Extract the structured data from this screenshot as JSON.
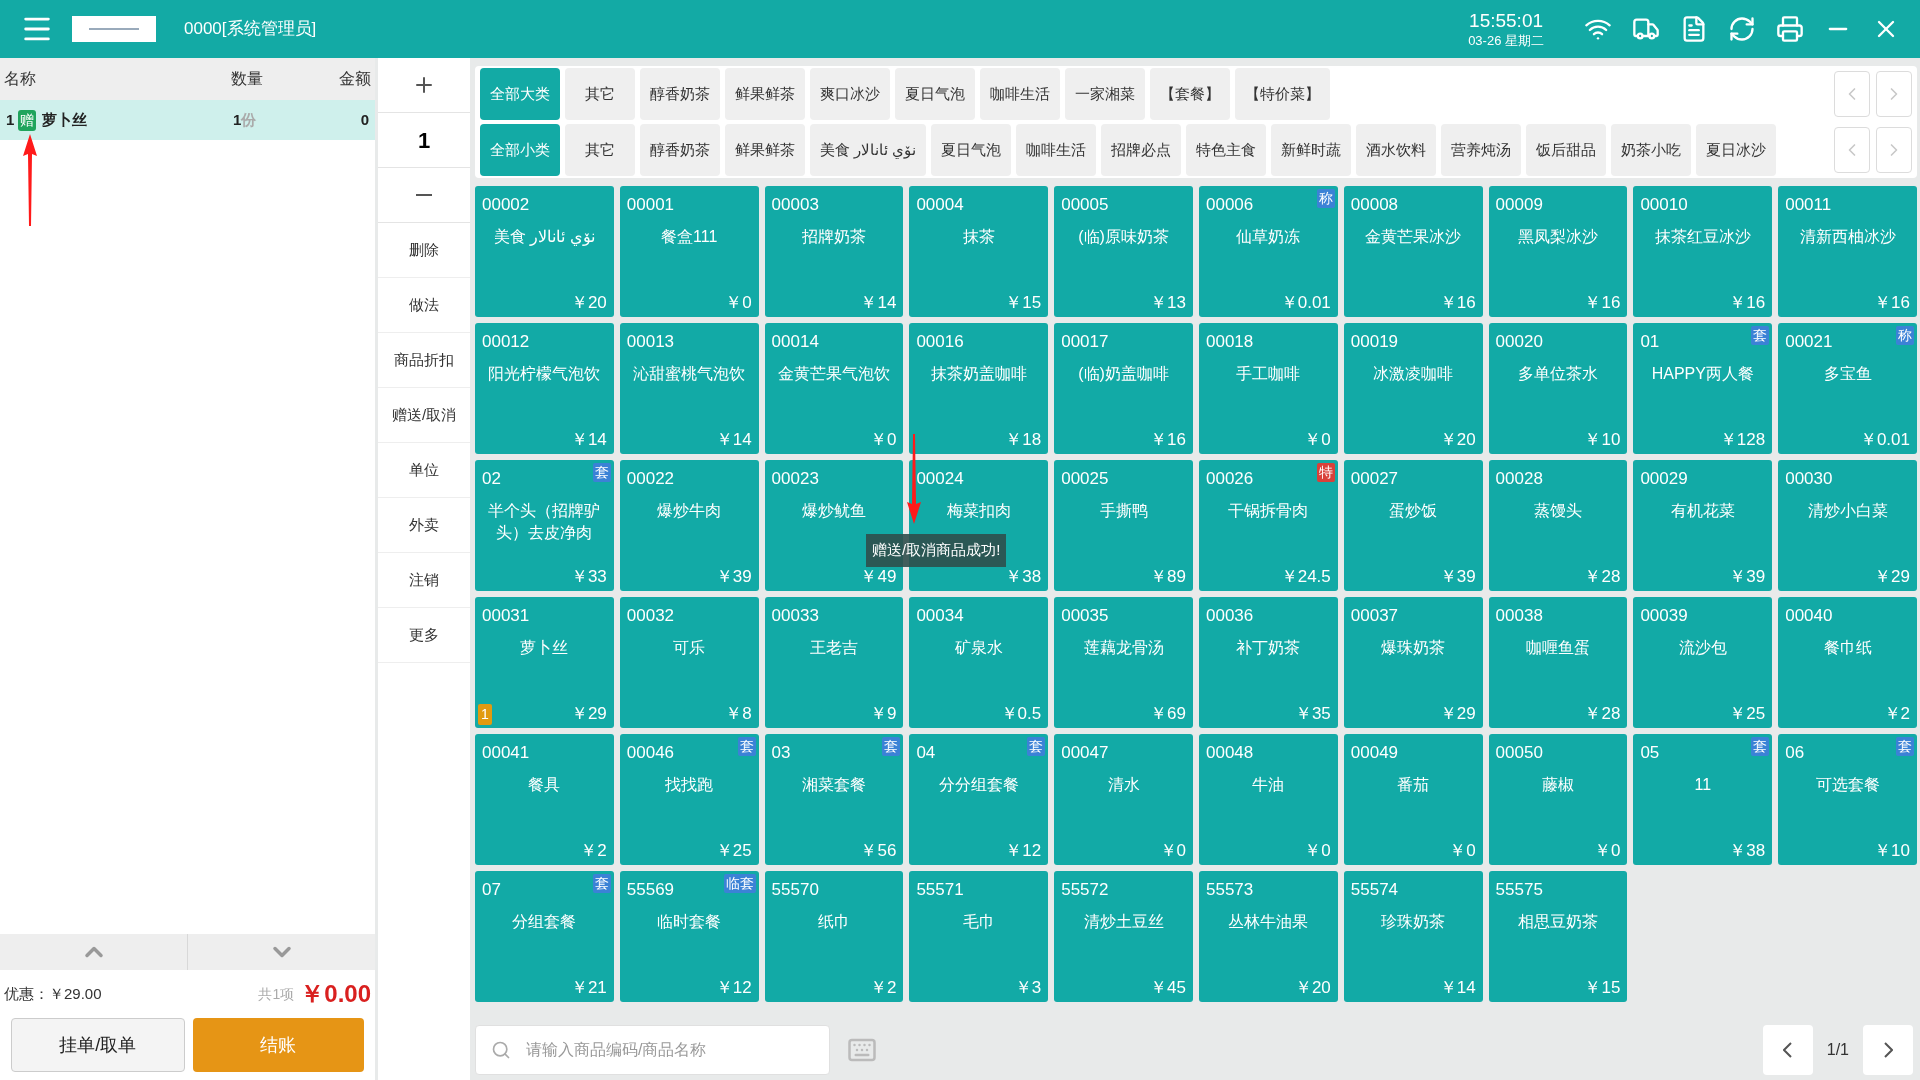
{
  "header": {
    "operator": "0000[系统管理员]",
    "time": "15:55:01",
    "date": "03-26 星期二"
  },
  "order": {
    "columns": [
      "名称",
      "数量",
      "金额"
    ],
    "items": [
      {
        "index": "1",
        "tag": "赠",
        "name": "萝卜丝",
        "qty": "1",
        "unit": "份",
        "amount": "0",
        "selected": true
      }
    ],
    "discount": "优惠：￥29.00",
    "count": "共1项",
    "total": "￥0.00",
    "buttons": [
      {
        "label": "挂单/取单",
        "kind": "plain"
      },
      {
        "label": "结账",
        "kind": "primary"
      }
    ]
  },
  "quantity": "1",
  "actions": [
    "删除",
    "做法",
    "商品折扣",
    "赠送/取消",
    "单位",
    "外卖",
    "注销",
    "更多"
  ],
  "categories": [
    {
      "label": "全部大类",
      "selected": true
    },
    {
      "label": "其它",
      "selected": false
    },
    {
      "label": "醇香奶茶",
      "selected": false
    },
    {
      "label": "鲜果鲜茶",
      "selected": false
    },
    {
      "label": "爽口冰沙",
      "selected": false
    },
    {
      "label": "夏日气泡",
      "selected": false
    },
    {
      "label": "咖啡生活",
      "selected": false
    },
    {
      "label": "一家湘菜",
      "selected": false
    },
    {
      "label": "【套餐】",
      "selected": false
    },
    {
      "label": "【特价菜】",
      "selected": false
    }
  ],
  "subcategories": [
    {
      "label": "全部小类",
      "selected": true
    },
    {
      "label": "其它",
      "selected": false
    },
    {
      "label": "醇香奶茶",
      "selected": false
    },
    {
      "label": "鲜果鲜茶",
      "selected": false
    },
    {
      "label": "美食 نۆي ئانالار",
      "selected": false
    },
    {
      "label": "夏日气泡",
      "selected": false
    },
    {
      "label": "咖啡生活",
      "selected": false
    },
    {
      "label": "招牌必点",
      "selected": false
    },
    {
      "label": "特色主食",
      "selected": false
    },
    {
      "label": "新鲜时蔬",
      "selected": false
    },
    {
      "label": "酒水饮料",
      "selected": false
    },
    {
      "label": "营养炖汤",
      "selected": false
    },
    {
      "label": "饭后甜品",
      "selected": false
    },
    {
      "label": "奶茶小吃",
      "selected": false
    },
    {
      "label": "夏日冰沙",
      "selected": false
    }
  ],
  "products": [
    {
      "code": "00002",
      "name": "美食 نۆي ئانالار",
      "price": "￥20"
    },
    {
      "code": "00001",
      "name": "餐盒111",
      "price": "￥0"
    },
    {
      "code": "00003",
      "name": "招牌奶茶",
      "price": "￥14"
    },
    {
      "code": "00004",
      "name": "抹茶",
      "price": "￥15"
    },
    {
      "code": "00005",
      "name": "(临)原味奶茶",
      "price": "￥13"
    },
    {
      "code": "00006",
      "name": "仙草奶冻",
      "price": "￥0.01",
      "badge": "称",
      "color": "#3b82d6"
    },
    {
      "code": "00008",
      "name": "金黄芒果冰沙",
      "price": "￥16"
    },
    {
      "code": "00009",
      "name": "黑凤梨冰沙",
      "price": "￥16"
    },
    {
      "code": "00010",
      "name": "抹茶红豆冰沙",
      "price": "￥16"
    },
    {
      "code": "00011",
      "name": "清新西柚冰沙",
      "price": "￥16"
    },
    {
      "code": "00012",
      "name": "阳光柠檬气泡饮",
      "price": "￥14"
    },
    {
      "code": "00013",
      "name": "沁甜蜜桃气泡饮",
      "price": "￥14"
    },
    {
      "code": "00014",
      "name": "金黄芒果气泡饮",
      "price": "￥0"
    },
    {
      "code": "00016",
      "name": "抹茶奶盖咖啡",
      "price": "￥18"
    },
    {
      "code": "00017",
      "name": "(临)奶盖咖啡",
      "price": "￥16"
    },
    {
      "code": "00018",
      "name": "手工咖啡",
      "price": "￥0"
    },
    {
      "code": "00019",
      "name": "冰激凌咖啡",
      "price": "￥20"
    },
    {
      "code": "00020",
      "name": "多单位茶水",
      "price": "￥10"
    },
    {
      "code": "01",
      "name": "HAPPY两人餐",
      "price": "￥128",
      "badge": "套",
      "color": "#3b82d6"
    },
    {
      "code": "00021",
      "name": "多宝鱼",
      "price": "￥0.01",
      "badge": "称",
      "color": "#3b82d6"
    },
    {
      "code": "02",
      "name": "半个头（招牌驴头）去皮净肉",
      "price": "￥33",
      "badge": "套",
      "color": "#3b82d6"
    },
    {
      "code": "00022",
      "name": "爆炒牛肉",
      "price": "￥39"
    },
    {
      "code": "00023",
      "name": "爆炒鱿鱼",
      "price": "￥49"
    },
    {
      "code": "00024",
      "name": "梅菜扣肉",
      "price": "￥38"
    },
    {
      "code": "00025",
      "name": "手撕鸭",
      "price": "￥89"
    },
    {
      "code": "00026",
      "name": "干锅拆骨肉",
      "price": "￥24.5",
      "badge": "特",
      "color": "#d9413a"
    },
    {
      "code": "00027",
      "name": "蛋炒饭",
      "price": "￥39"
    },
    {
      "code": "00028",
      "name": "蒸馒头",
      "price": "￥28"
    },
    {
      "code": "00029",
      "name": "有机花菜",
      "price": "￥39"
    },
    {
      "code": "00030",
      "name": "清炒小白菜",
      "price": "￥29"
    },
    {
      "code": "00031",
      "name": "萝卜丝",
      "price": "￥29",
      "count": "1"
    },
    {
      "code": "00032",
      "name": "可乐",
      "price": "￥8"
    },
    {
      "code": "00033",
      "name": "王老吉",
      "price": "￥9"
    },
    {
      "code": "00034",
      "name": "矿泉水",
      "price": "￥0.5"
    },
    {
      "code": "00035",
      "name": "莲藕龙骨汤",
      "price": "￥69"
    },
    {
      "code": "00036",
      "name": "补丁奶茶",
      "price": "￥35"
    },
    {
      "code": "00037",
      "name": "爆珠奶茶",
      "price": "￥29"
    },
    {
      "code": "00038",
      "name": "咖喱鱼蛋",
      "price": "￥28"
    },
    {
      "code": "00039",
      "name": "流沙包",
      "price": "￥25"
    },
    {
      "code": "00040",
      "name": "餐巾纸",
      "price": "￥2"
    },
    {
      "code": "00041",
      "name": "餐具",
      "price": "￥2"
    },
    {
      "code": "00046",
      "name": "找找跑",
      "price": "￥25",
      "badge": "套",
      "color": "#3b82d6"
    },
    {
      "code": "03",
      "name": "湘菜套餐",
      "price": "￥56",
      "badge": "套",
      "color": "#3b82d6"
    },
    {
      "code": "04",
      "name": "分分组套餐",
      "price": "￥12",
      "badge": "套",
      "color": "#3b82d6"
    },
    {
      "code": "00047",
      "name": "清水",
      "price": "￥0"
    },
    {
      "code": "00048",
      "name": "牛油",
      "price": "￥0"
    },
    {
      "code": "00049",
      "name": "番茄",
      "price": "￥0"
    },
    {
      "code": "00050",
      "name": "藤椒",
      "price": "￥0"
    },
    {
      "code": "05",
      "name": "11",
      "price": "￥38",
      "badge": "套",
      "color": "#3b82d6"
    },
    {
      "code": "06",
      "name": "可选套餐",
      "price": "￥10",
      "badge": "套",
      "color": "#3b82d6"
    },
    {
      "code": "07",
      "name": "分组套餐",
      "price": "￥21",
      "badge": "套",
      "color": "#3b82d6"
    },
    {
      "code": "55569",
      "name": "临时套餐",
      "price": "￥12",
      "badge": "临套",
      "color": "#3b82d6"
    },
    {
      "code": "55570",
      "name": "纸巾",
      "price": "￥2"
    },
    {
      "code": "55571",
      "name": "毛巾",
      "price": "￥3"
    },
    {
      "code": "55572",
      "name": "清炒土豆丝",
      "price": "￥45"
    },
    {
      "code": "55573",
      "name": "丛林牛油果",
      "price": "￥20"
    },
    {
      "code": "55574",
      "name": "珍珠奶茶",
      "price": "￥14"
    },
    {
      "code": "55575",
      "name": "相思豆奶茶",
      "price": "￥15"
    }
  ],
  "toast": "赠送/取消商品成功!",
  "search": {
    "placeholder": "请输入商品编码/商品名称"
  },
  "page": "1/1"
}
